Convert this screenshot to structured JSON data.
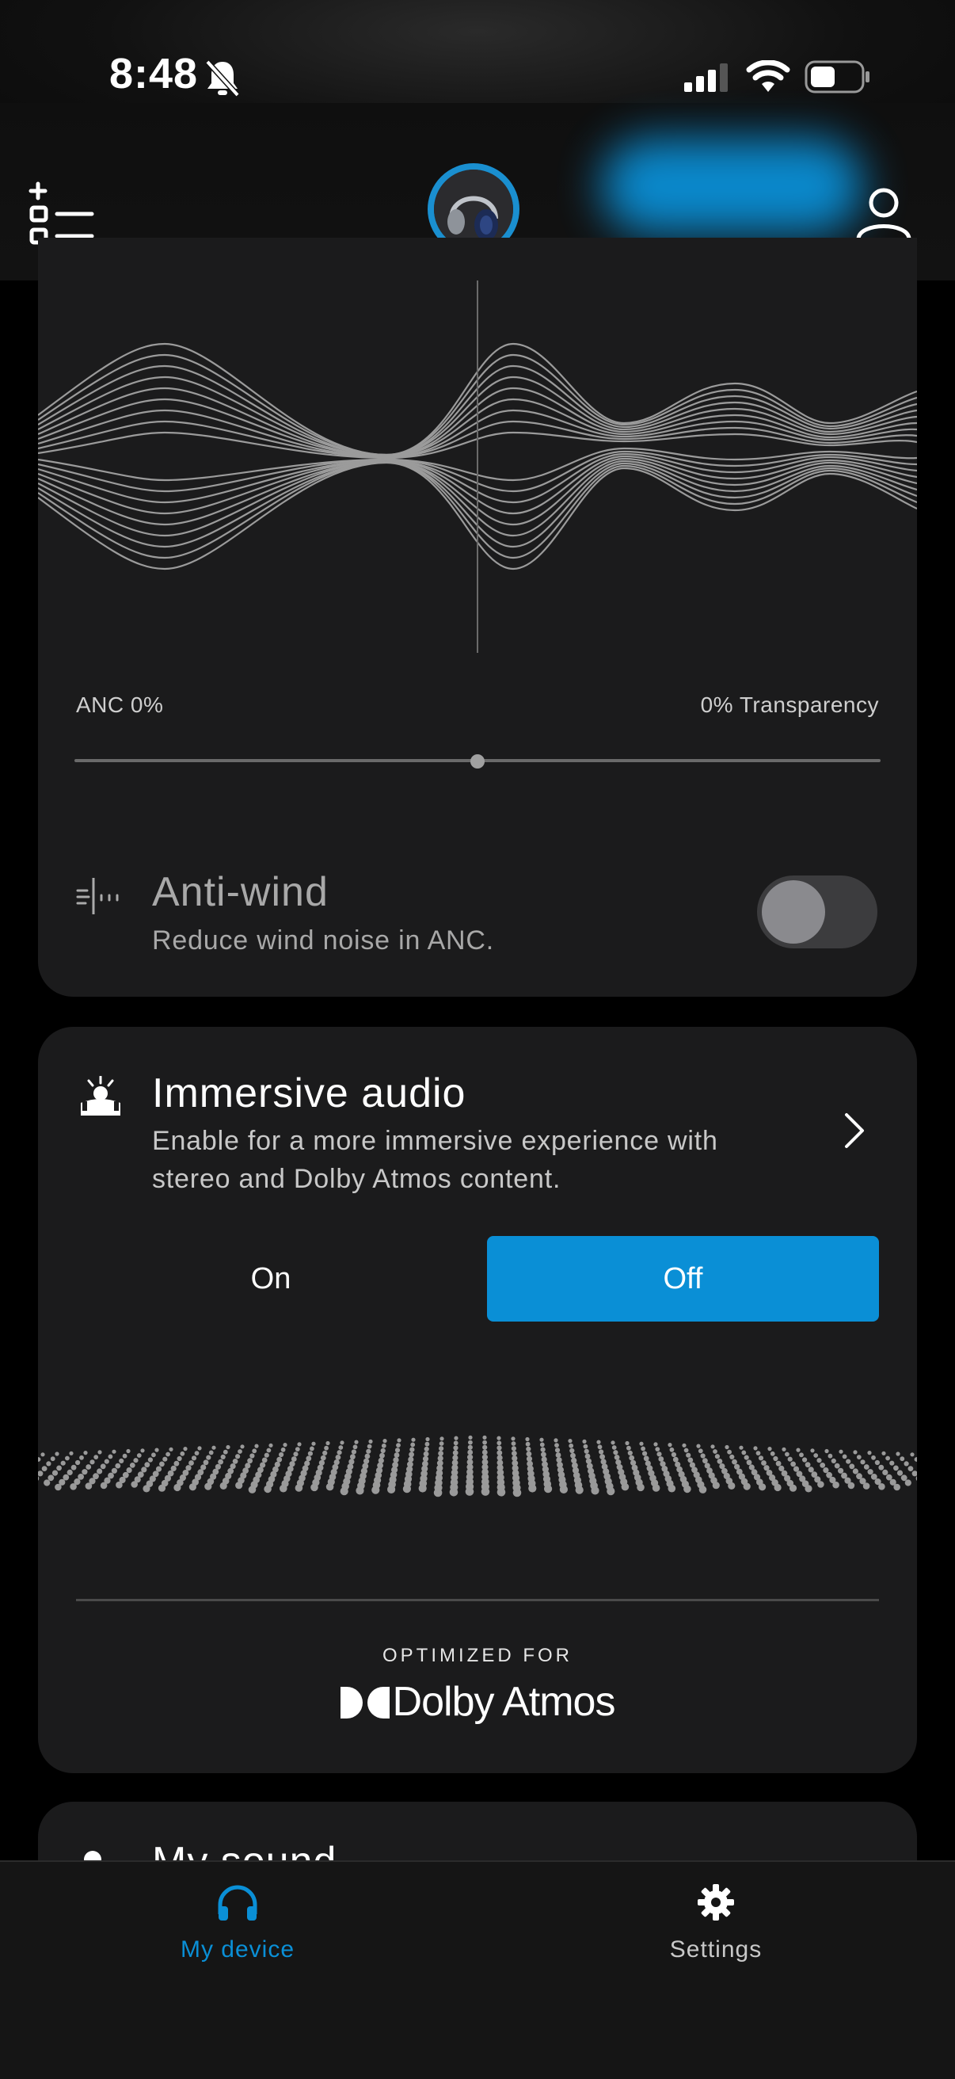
{
  "status": {
    "time": "8:48"
  },
  "colors": {
    "accent": "#0A8FD6",
    "card": "#1B1B1C",
    "background": "#000000"
  },
  "header": {
    "menu_icon": "list-add-icon",
    "device_icon": "headphones-avatar-icon",
    "profile_icon": "person-icon"
  },
  "anc": {
    "left_label": "ANC 0%",
    "right_label": "0% Transparency",
    "slider_value_percent": 50
  },
  "antiwind": {
    "icon": "wind-icon",
    "title": "Anti-wind",
    "subtitle": "Reduce wind noise in ANC.",
    "enabled": false
  },
  "immersive": {
    "icon": "immersive-person-icon",
    "title": "Immersive audio",
    "subtitle_line1": "Enable for a more immersive experience with",
    "subtitle_line2": "stereo and Dolby Atmos content.",
    "option_on": "On",
    "option_off": "Off",
    "selected": "Off",
    "optimized_label": "OPTIMIZED FOR",
    "brand": "Dolby Atmos"
  },
  "mysound": {
    "title": "My sound"
  },
  "tabs": [
    {
      "label": "My device",
      "icon": "headphones-icon",
      "active": true
    },
    {
      "label": "Settings",
      "icon": "gear-icon",
      "active": false
    }
  ]
}
